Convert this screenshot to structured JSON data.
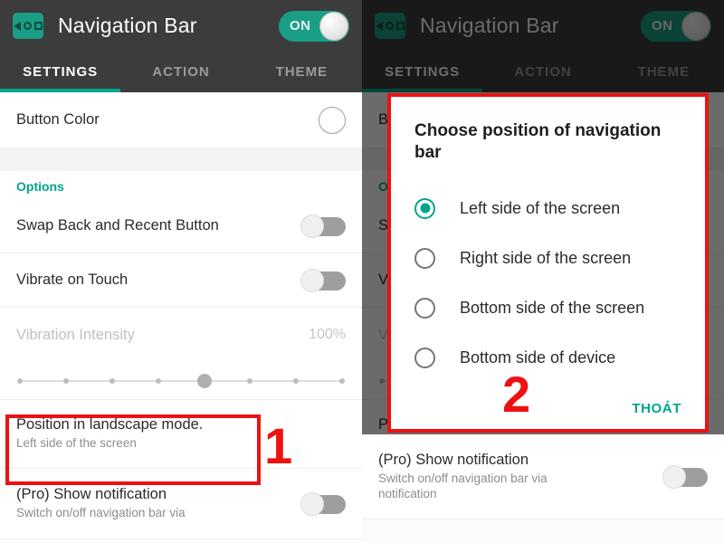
{
  "app": {
    "title": "Navigation Bar",
    "icon_name": "navigation-bar-app-icon",
    "power_toggle_label": "ON",
    "accent_color": "#00a68a",
    "appbar_color": "#3c3c3c",
    "annotation_color": "#ee1111"
  },
  "tabs": [
    {
      "label": "SETTINGS",
      "active": true
    },
    {
      "label": "ACTION",
      "active": false
    },
    {
      "label": "THEME",
      "active": false
    }
  ],
  "settings": {
    "button_color": {
      "label": "Button Color"
    },
    "options_header": "Options",
    "swap": {
      "label": "Swap Back and Recent Button",
      "state": "off"
    },
    "vibrate": {
      "label": "Vibrate on Touch",
      "state": "off"
    },
    "vibration_intensity": {
      "label": "Vibration Intensity",
      "value": "100%"
    },
    "slider": {
      "ticks": 8,
      "thumb_index": 4
    },
    "position": {
      "label": "Position in landscape mode.",
      "value": "Left side of the screen"
    },
    "pro_notification": {
      "label": "(Pro) Show notification",
      "sub": "Switch on/off navigation bar via notification",
      "sub_left_clipped": "Switch on/off navigation bar via",
      "state": "off"
    }
  },
  "annotations": {
    "step_one": "1",
    "step_two": "2"
  },
  "dialog": {
    "title": "Choose position of navigation bar",
    "options": [
      {
        "label": "Left side of the screen",
        "selected": true
      },
      {
        "label": "Right side of the screen",
        "selected": false
      },
      {
        "label": "Bottom side of the screen",
        "selected": false
      },
      {
        "label": "Bottom side of device",
        "selected": false
      }
    ],
    "dismiss_button": "THOÁT"
  }
}
